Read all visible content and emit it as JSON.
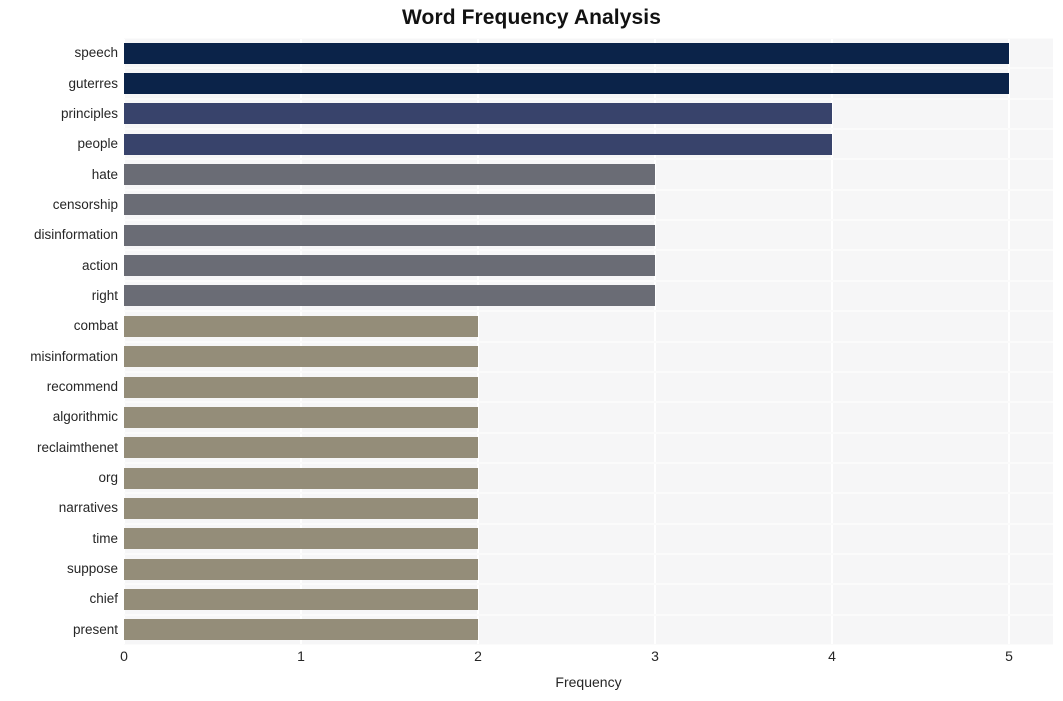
{
  "chart_data": {
    "type": "bar",
    "orientation": "horizontal",
    "title": "Word Frequency Analysis",
    "xlabel": "Frequency",
    "ylabel": "",
    "xlim": [
      0,
      5
    ],
    "xticks": [
      0,
      1,
      2,
      3,
      4,
      5
    ],
    "xtick_labels": [
      "0",
      "1",
      "2",
      "3",
      "4",
      "5"
    ],
    "grid": true,
    "legend": null,
    "categories": [
      "speech",
      "guterres",
      "principles",
      "people",
      "hate",
      "censorship",
      "disinformation",
      "action",
      "right",
      "combat",
      "misinformation",
      "recommend",
      "algorithmic",
      "reclaimthenet",
      "org",
      "narratives",
      "time",
      "suppose",
      "chief",
      "present"
    ],
    "values": [
      5,
      5,
      4,
      4,
      3,
      3,
      3,
      3,
      3,
      2,
      2,
      2,
      2,
      2,
      2,
      2,
      2,
      2,
      2,
      2
    ],
    "bar_colors": [
      "#0b2349",
      "#0b2349",
      "#38436b",
      "#38436b",
      "#6a6c75",
      "#6a6c75",
      "#6a6c75",
      "#6a6c75",
      "#6a6c75",
      "#948d79",
      "#948d79",
      "#948d79",
      "#948d79",
      "#948d79",
      "#948d79",
      "#948d79",
      "#948d79",
      "#948d79",
      "#948d79",
      "#948d79"
    ]
  },
  "style": {
    "plot_background": "#f6f6f7",
    "figure_background": "#ffffff",
    "gridline_color": "#ffffff",
    "text_color": "#262626",
    "title_color": "#121212"
  }
}
